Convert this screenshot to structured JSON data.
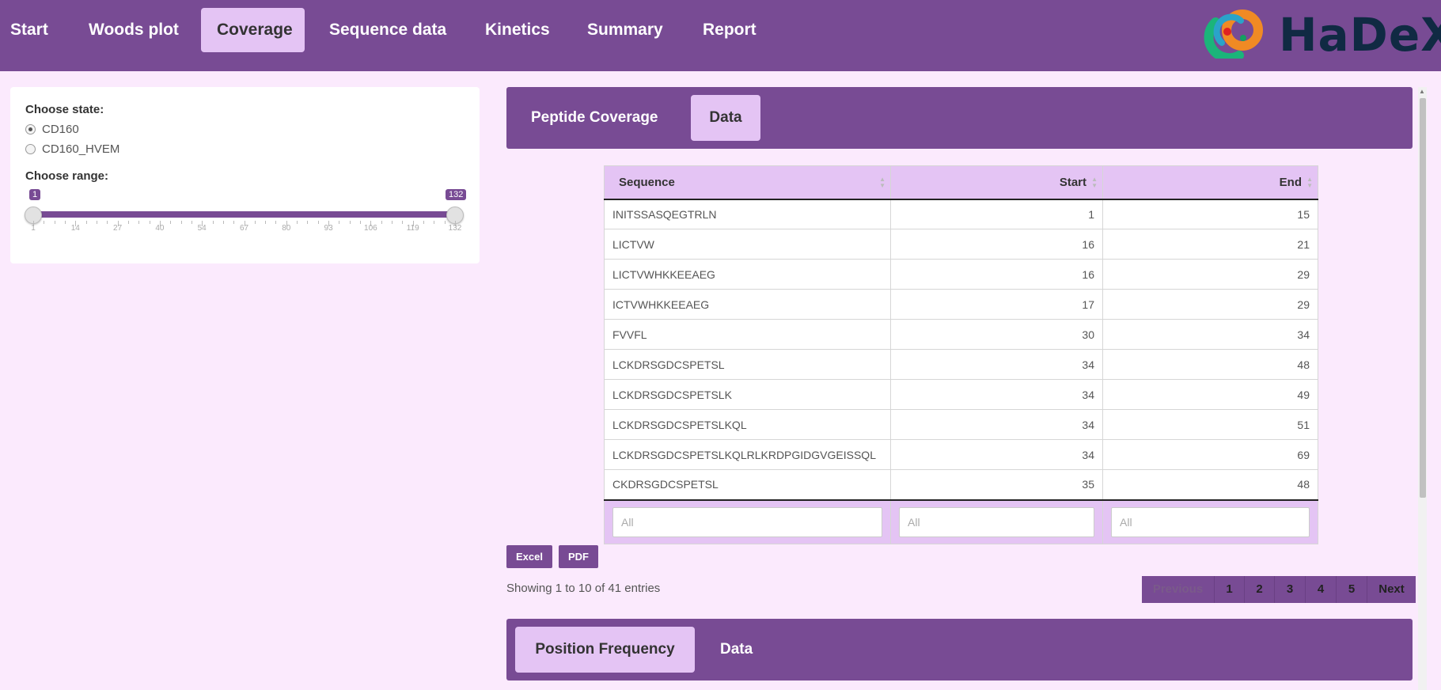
{
  "navbar": {
    "tabs": [
      {
        "label": "Start",
        "active": false
      },
      {
        "label": "Woods plot",
        "active": false
      },
      {
        "label": "Coverage",
        "active": true
      },
      {
        "label": "Sequence data",
        "active": false
      },
      {
        "label": "Kinetics",
        "active": false
      },
      {
        "label": "Summary",
        "active": false
      },
      {
        "label": "Report",
        "active": false
      }
    ],
    "logo_text": "HaDeX"
  },
  "sidebar": {
    "state_label": "Choose state:",
    "states": [
      {
        "label": "CD160",
        "checked": true
      },
      {
        "label": "CD160_HVEM",
        "checked": false
      }
    ],
    "range_label": "Choose range:",
    "range": {
      "min": 1,
      "max": 132,
      "from": "1",
      "to": "132",
      "tick_labels": [
        "1",
        "14",
        "27",
        "40",
        "54",
        "67",
        "80",
        "93",
        "106",
        "119",
        "132"
      ]
    }
  },
  "coverage_panel": {
    "tabs": [
      {
        "label": "Peptide Coverage",
        "active": false
      },
      {
        "label": "Data",
        "active": true
      }
    ]
  },
  "table": {
    "columns": [
      "Sequence",
      "Start",
      "End"
    ],
    "rows": [
      [
        "INITSSASQEGTRLN",
        "1",
        "15"
      ],
      [
        "LICTVW",
        "16",
        "21"
      ],
      [
        "LICTVWHKKEEAEG",
        "16",
        "29"
      ],
      [
        "ICTVWHKKEEAEG",
        "17",
        "29"
      ],
      [
        "FVVFL",
        "30",
        "34"
      ],
      [
        "LCKDRSGDCSPETSL",
        "34",
        "48"
      ],
      [
        "LCKDRSGDCSPETSLK",
        "34",
        "49"
      ],
      [
        "LCKDRSGDCSPETSLKQL",
        "34",
        "51"
      ],
      [
        "LCKDRSGDCSPETSLKQLRLKRDPGIDGVGEISSQL",
        "34",
        "69"
      ],
      [
        "CKDRSGDCSPETSL",
        "35",
        "48"
      ]
    ],
    "filter_placeholder": "All"
  },
  "buttons": {
    "excel": "Excel",
    "pdf": "PDF"
  },
  "info_text": "Showing 1 to 10 of 41 entries",
  "pagination": {
    "previous": "Previous",
    "pages": [
      "1",
      "2",
      "3",
      "4",
      "5"
    ],
    "next": "Next"
  },
  "frequency_panel": {
    "tabs": [
      {
        "label": "Position Frequency",
        "active": true
      },
      {
        "label": "Data",
        "active": false
      }
    ]
  },
  "colors": {
    "brand": "#784b94",
    "accent": "#e4c4f4",
    "background": "#fbeafd"
  }
}
